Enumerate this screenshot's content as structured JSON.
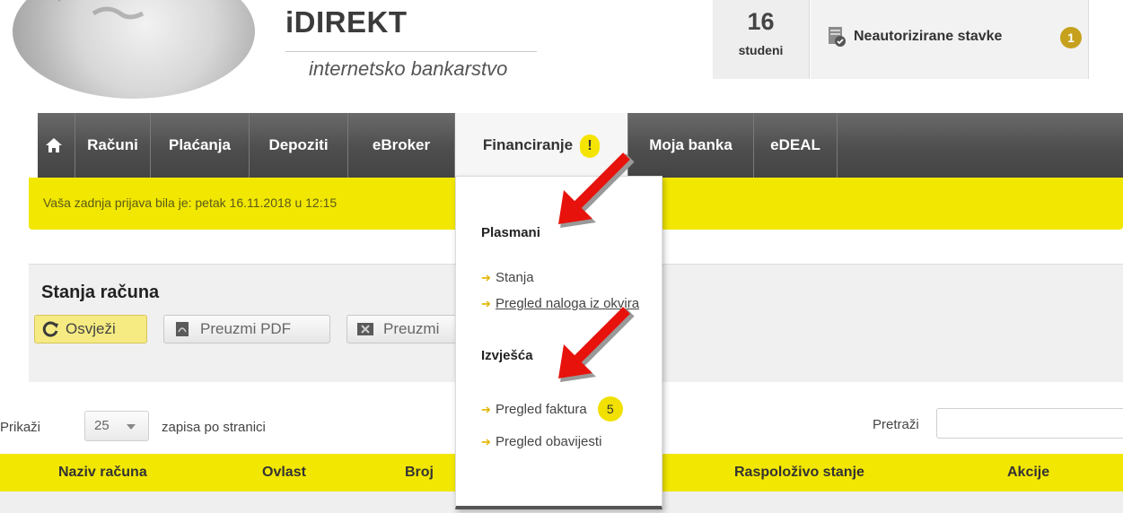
{
  "header": {
    "brand_title": "iDIREKT",
    "brand_subtitle": "internetsko bankarstvo",
    "date_day": "16",
    "date_month": "studeni",
    "unauthorized_label": "Neautorizirane stavke",
    "unauthorized_count": "1"
  },
  "nav": {
    "items": [
      {
        "label": "Računi"
      },
      {
        "label": "Plaćanja"
      },
      {
        "label": "Depoziti"
      },
      {
        "label": "eBroker"
      },
      {
        "label": "Financiranje"
      },
      {
        "label": "Moja banka"
      },
      {
        "label": "eDEAL"
      }
    ],
    "active_badge": "!"
  },
  "info_bar": {
    "text": "Vaša zadnja prijava bila je: petak 16.11.2018 u 12:15"
  },
  "dropdown": {
    "section1_title": "Plasmani",
    "section1_links": [
      {
        "label": "Stanja"
      },
      {
        "label": "Pregled naloga iz okvira"
      }
    ],
    "section2_title": "Izvješća",
    "section2_links": [
      {
        "label": "Pregled faktura",
        "badge": "5"
      },
      {
        "label": "Pregled obavijesti"
      }
    ]
  },
  "account_panel": {
    "title": "Stanja računa",
    "buttons": {
      "refresh": "Osvježi",
      "pdf": "Preuzmi PDF",
      "excel": "Preuzmi"
    }
  },
  "list_controls": {
    "show_label": "Prikaži",
    "page_size": "25",
    "per_page_label": "zapisa po stranici",
    "search_label": "Pretraži"
  },
  "table": {
    "columns": [
      "Naziv računa",
      "Ovlast",
      "Broj",
      "Raspoloživo stanje",
      "Akcije"
    ]
  },
  "colors": {
    "accent_yellow": "#f2e700",
    "nav_dark": "#4e4e4e",
    "arrow_red": "#e8120c"
  }
}
